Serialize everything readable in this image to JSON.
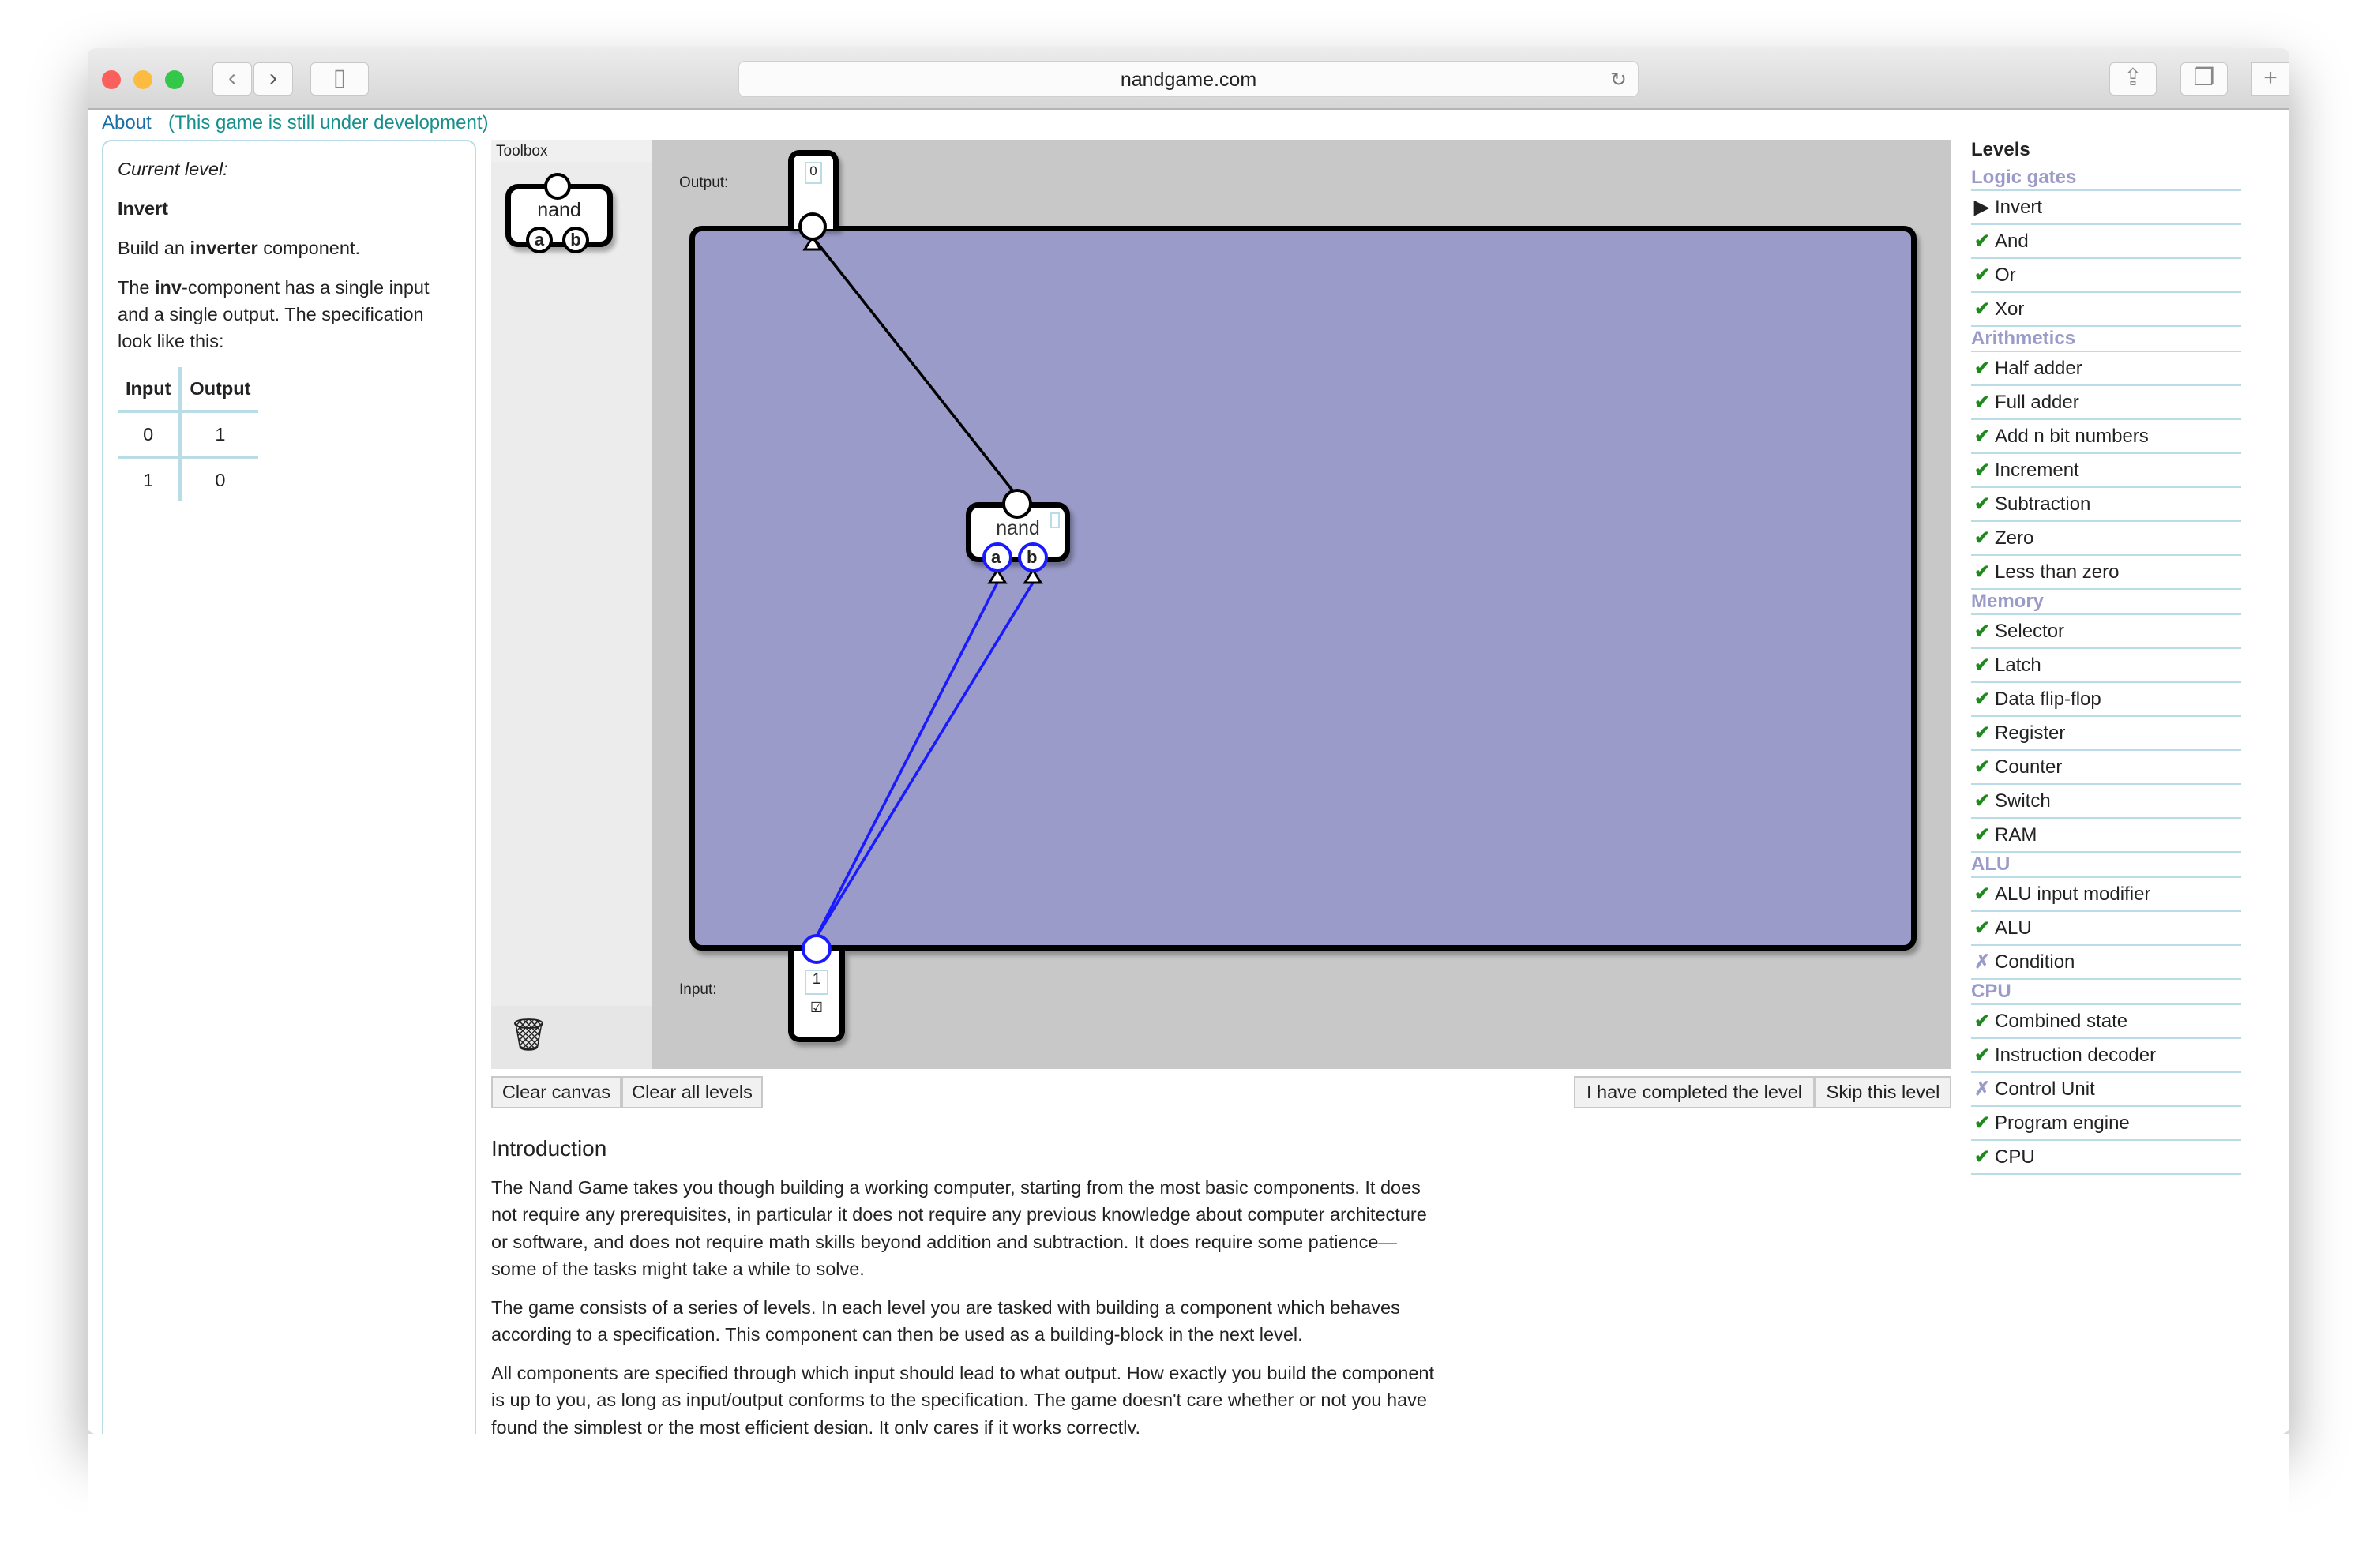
{
  "browser": {
    "url": "nandgame.com"
  },
  "topbar": {
    "about": "About",
    "notice": "(This game is still under development)"
  },
  "left": {
    "current_label": "Current level:",
    "level_name": "Invert",
    "desc1_pre": "Build an ",
    "desc1_bold": "inverter",
    "desc1_post": " component.",
    "desc2_pre": "The ",
    "desc2_bold": "inv",
    "desc2_post": "-component has a single input and a single output. The specification look like this:",
    "table": {
      "headers": [
        "Input",
        "Output"
      ],
      "rows": [
        [
          "0",
          "1"
        ],
        [
          "1",
          "0"
        ]
      ]
    }
  },
  "toolbox": {
    "title": "Toolbox",
    "component": "nand",
    "pin_a": "a",
    "pin_b": "b"
  },
  "canvas": {
    "output_label": "Output:",
    "output_value": "0",
    "input_label": "Input:",
    "input_value": "1",
    "input_checkbox": "☑",
    "gate": "nand",
    "pin_a": "a",
    "pin_b": "b"
  },
  "buttons": {
    "clear_canvas": "Clear canvas",
    "clear_all": "Clear all levels",
    "completed": "I have completed the level",
    "skip": "Skip this level"
  },
  "intro": {
    "title": "Introduction",
    "paragraphs": [
      "The Nand Game takes you though building a working computer, starting from the most basic components. It does not require any prerequisites, in particular it does not require any previous knowledge about computer architecture or software, and does not require math skills beyond addition and subtraction. It does require some patience—some of the tasks might take a while to solve.",
      "The game consists of a series of levels. In each level you are tasked with building a component which behaves according to a specification. This component can then be used as a building-block in the next level.",
      "All components are specified through which input should lead to what output. How exactly you build the component is up to you, as long as input/output conforms to the specification. The game doesn't care whether or not you have found the simplest or the most efficient design. It only cares if it works correctly."
    ]
  },
  "levels": {
    "title": "Levels",
    "groups": [
      {
        "name": "Logic gates",
        "items": [
          {
            "label": "Invert",
            "status": "current"
          },
          {
            "label": "And",
            "status": "done"
          },
          {
            "label": "Or",
            "status": "done"
          },
          {
            "label": "Xor",
            "status": "done"
          }
        ]
      },
      {
        "name": "Arithmetics",
        "items": [
          {
            "label": "Half adder",
            "status": "done"
          },
          {
            "label": "Full adder",
            "status": "done"
          },
          {
            "label": "Add n bit numbers",
            "status": "done"
          },
          {
            "label": "Increment",
            "status": "done"
          },
          {
            "label": "Subtraction",
            "status": "done"
          },
          {
            "label": "Zero",
            "status": "done"
          },
          {
            "label": "Less than zero",
            "status": "done"
          }
        ]
      },
      {
        "name": "Memory",
        "items": [
          {
            "label": "Selector",
            "status": "done"
          },
          {
            "label": "Latch",
            "status": "done"
          },
          {
            "label": "Data flip-flop",
            "status": "done"
          },
          {
            "label": "Register",
            "status": "done"
          },
          {
            "label": "Counter",
            "status": "done"
          },
          {
            "label": "Switch",
            "status": "done"
          },
          {
            "label": "RAM",
            "status": "done"
          }
        ]
      },
      {
        "name": "ALU",
        "items": [
          {
            "label": "ALU input modifier",
            "status": "done"
          },
          {
            "label": "ALU",
            "status": "done"
          },
          {
            "label": "Condition",
            "status": "failed"
          }
        ]
      },
      {
        "name": "CPU",
        "items": [
          {
            "label": "Combined state",
            "status": "done"
          },
          {
            "label": "Instruction decoder",
            "status": "done"
          },
          {
            "label": "Control Unit",
            "status": "failed"
          },
          {
            "label": "Program engine",
            "status": "done"
          },
          {
            "label": "CPU",
            "status": "done"
          }
        ]
      }
    ]
  },
  "colors": {
    "board": "#9a9bc8",
    "wire_active": "#1a1aff",
    "check": "#1e8a1e",
    "group": "#9a9bc8"
  }
}
